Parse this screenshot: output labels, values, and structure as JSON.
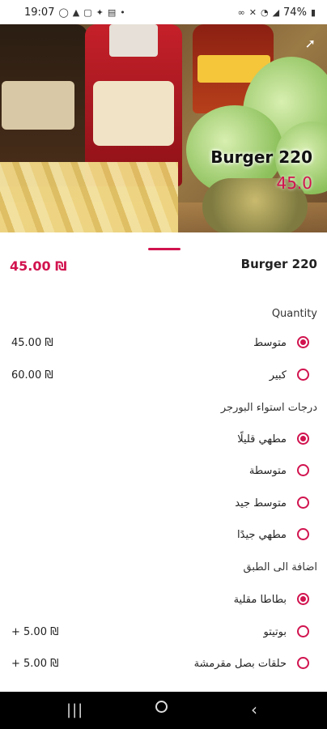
{
  "status_bar": {
    "time": "19:07",
    "battery": "74%",
    "left_icons": [
      "whatsapp-icon",
      "alert-icon",
      "instagram-icon",
      "twitter-icon",
      "news-icon",
      "dot-icon"
    ],
    "right_icons": [
      "link-icon",
      "mute-icon",
      "wifi-icon",
      "signal-icon",
      "battery-icon"
    ]
  },
  "hero": {
    "name": "Burger 220",
    "price": "45.0",
    "share_icon": "share-icon"
  },
  "product": {
    "price": "45.00 ₪",
    "name": "Burger 220"
  },
  "quantity": {
    "title": "Quantity",
    "options": [
      {
        "label": "متوسط",
        "price": "45.00 ₪",
        "checked": true
      },
      {
        "label": "كبير",
        "price": "60.00 ₪",
        "checked": false
      }
    ]
  },
  "doneness": {
    "title": "درجات استواء البورجر",
    "options": [
      {
        "label": "مطهي قليلًا",
        "checked": true
      },
      {
        "label": "متوسطة",
        "checked": false
      },
      {
        "label": "متوسط جيد",
        "checked": false
      },
      {
        "label": "مطهي جيدًا",
        "checked": false
      }
    ]
  },
  "additions": {
    "title": "اضافة الى الطبق",
    "options": [
      {
        "label": "بطاطا مقلية",
        "price": "",
        "checked": true
      },
      {
        "label": "بوتيتو",
        "price": "+ 5.00 ₪",
        "checked": false
      },
      {
        "label": "حلقات بصل مقرمشة",
        "price": "+ 5.00 ₪",
        "checked": false
      }
    ]
  },
  "colors": {
    "accent": "#d1134f"
  }
}
